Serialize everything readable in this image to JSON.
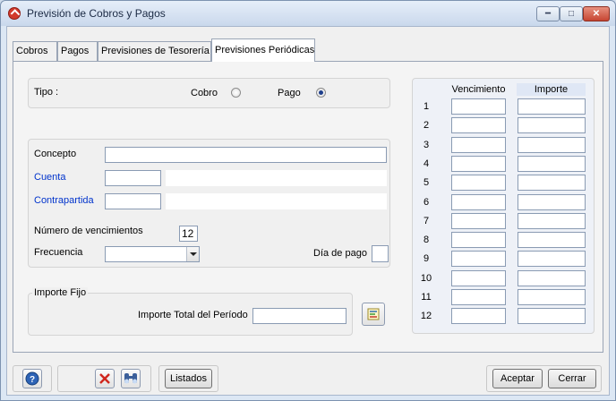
{
  "window": {
    "title": "Previsión de Cobros y Pagos"
  },
  "tabs": [
    {
      "label": "Cobros"
    },
    {
      "label": "Pagos"
    },
    {
      "label": "Previsiones de Tesorería"
    },
    {
      "label": "Previsiones Periódicas"
    }
  ],
  "tipo": {
    "label": "Tipo :",
    "cobro_label": "Cobro",
    "pago_label": "Pago",
    "selected": "Pago"
  },
  "form": {
    "concepto_label": "Concepto",
    "concepto_value": "",
    "cuenta_label": "Cuenta",
    "cuenta_code": "",
    "cuenta_name": "",
    "contrapartida_label": "Contrapartida",
    "contrapartida_code": "",
    "contrapartida_name": "",
    "num_vencimientos_label": "Número de vencimientos",
    "num_vencimientos_value": "12",
    "frecuencia_label": "Frecuencia",
    "frecuencia_value": "",
    "dia_pago_label": "Día de pago",
    "dia_pago_value": ""
  },
  "importe_fijo": {
    "legend": "Importe Fijo",
    "total_label": "Importe Total del Período",
    "total_value": ""
  },
  "schedule": {
    "col_vencimiento": "Vencimiento",
    "col_importe": "Importe",
    "rows": [
      "1",
      "2",
      "3",
      "4",
      "5",
      "6",
      "7",
      "8",
      "9",
      "10",
      "11",
      "12"
    ]
  },
  "buttons": {
    "listados": "Listados",
    "aceptar": "Aceptar",
    "cerrar": "Cerrar"
  },
  "colors": {
    "label_blue": "#0033cc",
    "close_red": "#c64532"
  }
}
